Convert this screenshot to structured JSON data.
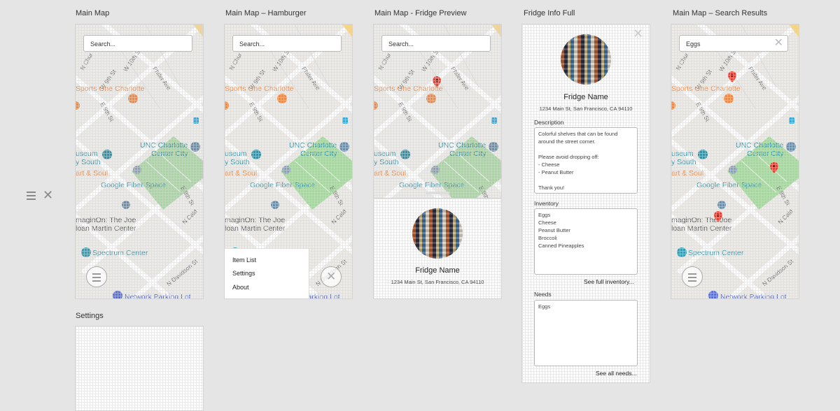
{
  "artboards": {
    "main_map": {
      "label": "Main Map"
    },
    "hamburger": {
      "label": "Main Map – Hamburger"
    },
    "fridge_preview": {
      "label": "Main Map - Fridge Preview"
    },
    "fridge_full": {
      "label": "Fridge Info Full"
    },
    "search_results": {
      "label": "Main Map – Search Results"
    },
    "settings": {
      "label": "Settings"
    }
  },
  "search": {
    "placeholder": "Search...",
    "results_query": "Eggs"
  },
  "map_labels": {
    "sports": "Sports One Charlotte",
    "unc": "UNC Charlotte",
    "unc2": "Center City",
    "museum": "useum",
    "museum2": "y South",
    "art": "art & Soul",
    "fiber": "Google Fiber Space",
    "imagin": "maginOn: The Joe",
    "imagin2": "loan Martin Center",
    "spectrum": "Spectrum Center",
    "parking": "Network Parking Lot",
    "davidson": "N Davidson St",
    "caldwell": "N Cald",
    "church": "N Chur",
    "ninth": "W 9th St",
    "tenth": "W 10th St",
    "phifer": "Phifer Ave",
    "e9th": "E 9th St",
    "e8th": "E 8th St",
    "e7th": "E 7th St"
  },
  "menu": {
    "items": [
      "Item List",
      "Settings",
      "About"
    ]
  },
  "fridge": {
    "name": "Fridge Name",
    "address": "1234 Main St, San Francisco, CA 94110",
    "description_label": "Description",
    "description_lines": [
      "Colorful shelves that can be found",
      "around the street corner.",
      "",
      "Please avoid dropping off:",
      "- Cheese",
      "- Peanut Butter",
      "",
      "Thank you!"
    ],
    "inventory_label": "Inventory",
    "inventory": [
      "Eggs",
      "Cheese",
      "Peanut Butter",
      "Broccoli",
      "Canned Pineapples"
    ],
    "see_inventory": "See full inventory...",
    "needs_label": "Needs",
    "needs": [
      "Eggs"
    ],
    "see_needs": "See all needs..."
  },
  "side_controls": {
    "menu_icon": "hamburger-icon",
    "close_icon": "close-icon"
  },
  "colors": {
    "pin": "#e0453a",
    "park": "#a8d5a2",
    "orange_poi": "#e88b4c",
    "teal_poi": "#3a8ea0"
  }
}
